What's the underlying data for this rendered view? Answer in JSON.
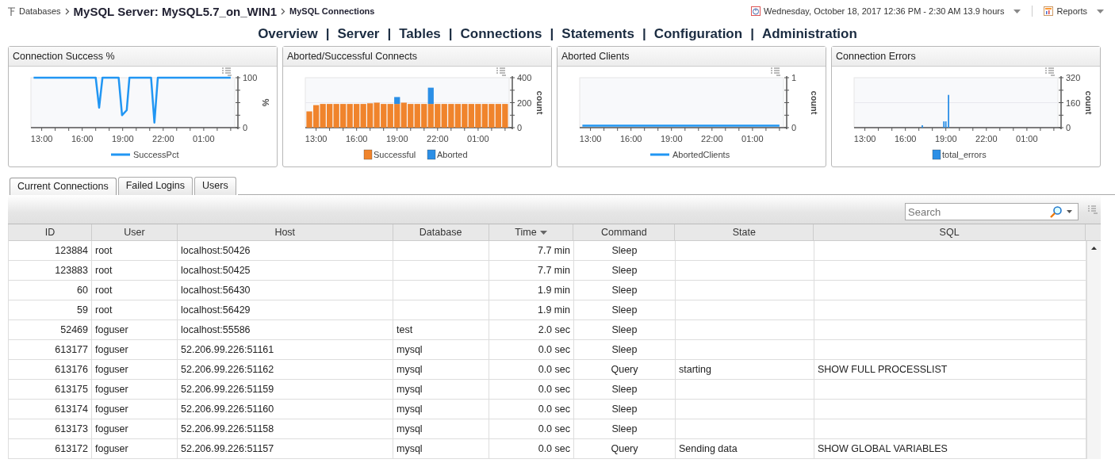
{
  "breadcrumb": [
    {
      "label": "Databases"
    },
    {
      "label": "MySQL Server: MySQL5.7_on_WIN1"
    },
    {
      "label": "MySQL Connections"
    }
  ],
  "time_range": {
    "label": "Wednesday, October 18, 2017 12:36 PM - 2:30 AM 13.9 hours"
  },
  "reports": {
    "label": "Reports"
  },
  "nav": {
    "separator": "|",
    "items": [
      {
        "label": "Overview"
      },
      {
        "label": "Server"
      },
      {
        "label": "Tables"
      },
      {
        "label": "Connections"
      },
      {
        "label": "Statements"
      },
      {
        "label": "Configuration"
      },
      {
        "label": "Administration"
      }
    ]
  },
  "charts": [
    {
      "chart_data": {
        "type": "line",
        "title": "Connection Success %",
        "ylabel": "%",
        "legend": "bottom",
        "xlim": [
          "2017-10-18T12:12",
          "2017-10-19T03:18"
        ],
        "ylim": [
          0,
          100
        ],
        "xticks": [
          {
            "value": "2017-10-18T13:00",
            "label": "13:00"
          },
          {
            "value": "2017-10-18T16:00",
            "label": "16:00"
          },
          {
            "value": "2017-10-18T19:00",
            "label": "19:00"
          },
          {
            "value": "2017-10-18T22:00",
            "label": "22:00"
          },
          {
            "value": "2017-10-19T01:00",
            "label": "01:00"
          }
        ],
        "yticks": [
          0,
          100
        ],
        "x": [
          "2017-10-18T12:24",
          "2017-10-18T17:00",
          "2017-10-18T17:15",
          "2017-10-18T17:30",
          "2017-10-18T18:42",
          "2017-10-18T18:57",
          "2017-10-18T19:18",
          "2017-10-18T19:30",
          "2017-10-18T21:06",
          "2017-10-18T21:21",
          "2017-10-18T21:36",
          "2017-10-19T03:00"
        ],
        "series": [
          {
            "name": "SuccessPct",
            "color": "#2196f3",
            "values": [
              100,
              100,
              40,
              100,
              100,
              25,
              35,
              100,
              100,
              10,
              100,
              100
            ]
          }
        ]
      }
    },
    {
      "chart_data": {
        "type": "bar",
        "title": "Aborted/Successful Connects",
        "ylabel": "count",
        "legend": "bottom",
        "stacked": true,
        "xlim": [
          "2017-10-18T12:12",
          "2017-10-19T03:18"
        ],
        "ylim": [
          0,
          400
        ],
        "xticks": [
          {
            "value": "2017-10-18T13:00",
            "label": "13:00"
          },
          {
            "value": "2017-10-18T16:00",
            "label": "16:00"
          },
          {
            "value": "2017-10-18T19:00",
            "label": "19:00"
          },
          {
            "value": "2017-10-18T22:00",
            "label": "22:00"
          },
          {
            "value": "2017-10-19T01:00",
            "label": "01:00"
          }
        ],
        "yticks": [
          0,
          200,
          400
        ],
        "x": [
          "2017-10-18T12:30",
          "2017-10-18T13:00",
          "2017-10-18T13:30",
          "2017-10-18T14:00",
          "2017-10-18T14:30",
          "2017-10-18T15:00",
          "2017-10-18T15:30",
          "2017-10-18T16:00",
          "2017-10-18T16:30",
          "2017-10-18T17:00",
          "2017-10-18T17:30",
          "2017-10-18T18:00",
          "2017-10-18T18:30",
          "2017-10-18T19:00",
          "2017-10-18T19:30",
          "2017-10-18T20:00",
          "2017-10-18T20:30",
          "2017-10-18T21:00",
          "2017-10-18T21:30",
          "2017-10-18T22:00",
          "2017-10-18T22:30",
          "2017-10-18T23:00",
          "2017-10-18T23:30",
          "2017-10-19T00:00",
          "2017-10-19T00:30",
          "2017-10-19T01:00",
          "2017-10-19T01:30",
          "2017-10-19T02:00",
          "2017-10-19T02:30",
          "2017-10-19T03:00"
        ],
        "series": [
          {
            "name": "Successful",
            "color": "#f0842c",
            "values": [
              130,
              180,
              190,
              190,
              190,
              190,
              190,
              190,
              190,
              195,
              200,
              190,
              190,
              190,
              200,
              190,
              190,
              190,
              190,
              190,
              190,
              190,
              190,
              190,
              190,
              190,
              190,
              190,
              190,
              190
            ]
          },
          {
            "name": "Aborted",
            "color": "#2b8fe6",
            "values": [
              0,
              0,
              0,
              0,
              0,
              0,
              0,
              0,
              0,
              0,
              0,
              0,
              0,
              55,
              0,
              0,
              0,
              0,
              130,
              0,
              0,
              0,
              0,
              0,
              0,
              0,
              0,
              0,
              0,
              0
            ]
          }
        ]
      }
    },
    {
      "chart_data": {
        "type": "line",
        "title": "Aborted Clients",
        "ylabel": "count",
        "legend": "bottom",
        "xlim": [
          "2017-10-18T12:12",
          "2017-10-19T03:18"
        ],
        "ylim": [
          0,
          1
        ],
        "xticks": [
          {
            "value": "2017-10-18T13:00",
            "label": "13:00"
          },
          {
            "value": "2017-10-18T16:00",
            "label": "16:00"
          },
          {
            "value": "2017-10-18T19:00",
            "label": "19:00"
          },
          {
            "value": "2017-10-18T22:00",
            "label": "22:00"
          },
          {
            "value": "2017-10-19T01:00",
            "label": "01:00"
          }
        ],
        "yticks": [
          0,
          1
        ],
        "x": [
          "2017-10-18T12:24",
          "2017-10-19T03:00"
        ],
        "series": [
          {
            "name": "AbortedClients",
            "color": "#2196f3",
            "values": [
              0.04,
              0.04
            ]
          }
        ]
      }
    },
    {
      "chart_data": {
        "type": "bar",
        "title": "Connection Errors",
        "ylabel": "count",
        "legend": "bottom",
        "xlim": [
          "2017-10-18T12:12",
          "2017-10-19T03:18"
        ],
        "ylim": [
          0,
          320
        ],
        "xticks": [
          {
            "value": "2017-10-18T13:00",
            "label": "13:00"
          },
          {
            "value": "2017-10-18T16:00",
            "label": "16:00"
          },
          {
            "value": "2017-10-18T19:00",
            "label": "19:00"
          },
          {
            "value": "2017-10-18T22:00",
            "label": "22:00"
          },
          {
            "value": "2017-10-19T01:00",
            "label": "01:00"
          }
        ],
        "yticks": [
          0,
          160,
          320
        ],
        "x": [
          "2017-10-18T17:15",
          "2017-10-18T18:51",
          "2017-10-18T19:00",
          "2017-10-18T19:12"
        ],
        "series": [
          {
            "name": "total_errors",
            "color": "#2b8fe6",
            "values": [
              15,
              40,
              40,
              210
            ]
          }
        ]
      }
    }
  ],
  "tabs": [
    {
      "label": "Current Connections",
      "selected": true
    },
    {
      "label": "Failed Logins",
      "selected": false
    },
    {
      "label": "Users",
      "selected": false
    }
  ],
  "search": {
    "placeholder": "Search"
  },
  "table": {
    "columns": [
      {
        "label": "ID",
        "sorted": false
      },
      {
        "label": "User",
        "sorted": false
      },
      {
        "label": "Host",
        "sorted": false
      },
      {
        "label": "Database",
        "sorted": false
      },
      {
        "label": "Time",
        "sorted": true
      },
      {
        "label": "Command",
        "sorted": false
      },
      {
        "label": "State",
        "sorted": false
      },
      {
        "label": "SQL",
        "sorted": false
      }
    ],
    "rows": [
      [
        "123884",
        "root",
        "localhost:50426",
        "",
        "7.7 min",
        "Sleep",
        "",
        ""
      ],
      [
        "123883",
        "root",
        "localhost:50425",
        "",
        "7.7 min",
        "Sleep",
        "",
        ""
      ],
      [
        "60",
        "root",
        "localhost:56430",
        "",
        "1.9 min",
        "Sleep",
        "",
        ""
      ],
      [
        "59",
        "root",
        "localhost:56429",
        "",
        "1.9 min",
        "Sleep",
        "",
        ""
      ],
      [
        "52469",
        "foguser",
        "localhost:55586",
        "test",
        "2.0 sec",
        "Sleep",
        "",
        ""
      ],
      [
        "613177",
        "foguser",
        "52.206.99.226:51161",
        "mysql",
        "0.0 sec",
        "Sleep",
        "",
        ""
      ],
      [
        "613176",
        "foguser",
        "52.206.99.226:51162",
        "mysql",
        "0.0 sec",
        "Query",
        "starting",
        "SHOW FULL PROCESSLIST"
      ],
      [
        "613175",
        "foguser",
        "52.206.99.226:51159",
        "mysql",
        "0.0 sec",
        "Sleep",
        "",
        ""
      ],
      [
        "613174",
        "foguser",
        "52.206.99.226:51160",
        "mysql",
        "0.0 sec",
        "Sleep",
        "",
        ""
      ],
      [
        "613173",
        "foguser",
        "52.206.99.226:51158",
        "mysql",
        "0.0 sec",
        "Sleep",
        "",
        ""
      ],
      [
        "613172",
        "foguser",
        "52.206.99.226:51157",
        "mysql",
        "0.0 sec",
        "Query",
        "Sending data",
        "SHOW GLOBAL VARIABLES"
      ]
    ]
  }
}
